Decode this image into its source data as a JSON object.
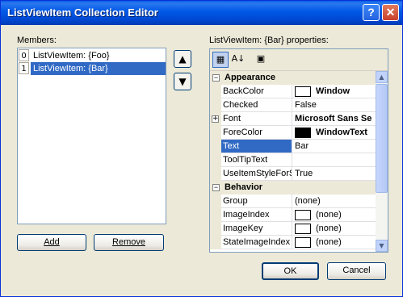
{
  "window": {
    "title": "ListViewItem Collection Editor"
  },
  "members": {
    "label": "Members:",
    "items": [
      {
        "index": "0",
        "text": "ListViewItem: {Foo}"
      },
      {
        "index": "1",
        "text": "ListViewItem: {Bar}"
      }
    ],
    "up_icon": "arrow-up-icon",
    "down_icon": "arrow-down-icon",
    "add_label": "Add",
    "remove_label": "Remove"
  },
  "properties": {
    "label": "ListViewItem: {Bar} properties:",
    "categories": [
      {
        "name": "Appearance",
        "rows": [
          {
            "name": "BackColor",
            "value": "Window",
            "swatch": "#ffffff"
          },
          {
            "name": "Checked",
            "value": "False"
          },
          {
            "name": "Font",
            "value": "Microsoft Sans Se",
            "expandable": "+"
          },
          {
            "name": "ForeColor",
            "value": "WindowText",
            "swatch": "#000000"
          },
          {
            "name": "Text",
            "value": "Bar"
          },
          {
            "name": "ToolTipText",
            "value": ""
          },
          {
            "name": "UseItemStyleForS",
            "value": "True"
          }
        ]
      },
      {
        "name": "Behavior",
        "rows": [
          {
            "name": "Group",
            "value": "(none)"
          },
          {
            "name": "ImageIndex",
            "value": "(none)",
            "swatch": "#ffffff"
          },
          {
            "name": "ImageKey",
            "value": "(none)",
            "swatch": "#ffffff"
          },
          {
            "name": "StateImageIndex",
            "value": "(none)",
            "swatch": "#ffffff"
          }
        ]
      }
    ]
  },
  "buttons": {
    "ok": "OK",
    "cancel": "Cancel"
  },
  "titlebar_buttons": {
    "help": "?",
    "close": "✕"
  }
}
